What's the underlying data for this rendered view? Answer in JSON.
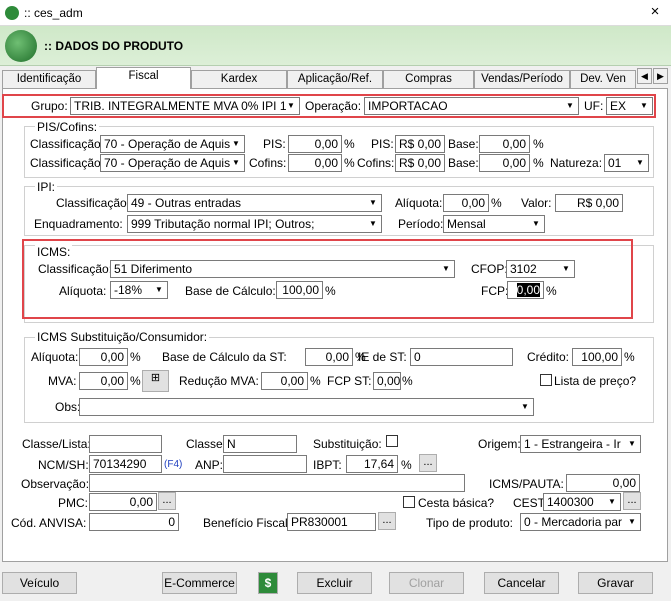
{
  "window": {
    "title": ":: ces_adm",
    "header": ":: DADOS DO PRODUTO"
  },
  "tabs": [
    "Identificação",
    "Fiscal",
    "Kardex",
    "Aplicação/Ref.",
    "Compras",
    "Vendas/Período",
    "Dev. Ven"
  ],
  "top": {
    "grupo_label": "Grupo:",
    "grupo_value": "TRIB. INTEGRALMENTE MVA 0% IPI 1",
    "operacao_label": "Operação:",
    "operacao_value": "IMPORTACAO",
    "uf_label": "UF:",
    "uf_value": "EX"
  },
  "piscofins": {
    "title": "PIS/Cofins:",
    "class_label": "Classificação:",
    "class1": "70 - Operação de Aquis",
    "class2": "70 - Operação de Aquis",
    "pis_label": "PIS:",
    "pis_pct": "0,00",
    "pct": "%",
    "pis2_label": "PIS:",
    "pis_val": "R$ 0,00",
    "base_label": "Base:",
    "base1": "0,00",
    "cofins_label": "Cofins:",
    "cofins_pct": "0,00",
    "cofins2_label": "Cofins:",
    "cofins_val": "R$ 0,00",
    "base2": "0,00",
    "natureza_label": "Natureza:",
    "natureza": "01"
  },
  "ipi": {
    "title": "IPI:",
    "class_label": "Classificação:",
    "class": "49 - Outras entradas",
    "aliq_label": "Alíquota:",
    "aliq": "0,00",
    "valor_label": "Valor:",
    "valor": "R$ 0,00",
    "enq_label": "Enquadramento:",
    "enq": "999 Tributação normal IPI; Outros;",
    "periodo_label": "Período:",
    "periodo": "Mensal"
  },
  "icms": {
    "title": "ICMS:",
    "class_label": "Classificação:",
    "class": "51 Diferimento",
    "cfop_label": "CFOP:",
    "cfop": "3102",
    "aliq_label": "Alíquota:",
    "aliq": "-18%",
    "base_label": "Base de Cálculo:",
    "base": "100,00",
    "fcp_label": "FCP:",
    "fcp": "0,00"
  },
  "icmsst": {
    "title": "ICMS Substituição/Consumidor:",
    "aliq_label": "Alíquota:",
    "aliq": "0,00",
    "base_label": "Base de Cálculo da ST:",
    "base": "0,00",
    "ie_label": "IE de ST:",
    "ie": "0",
    "credito_label": "Crédito:",
    "credito": "100,00",
    "mva_label": "MVA:",
    "mva": "0,00",
    "red_label": "Redução MVA:",
    "red": "0,00",
    "fcpst_label": "FCP ST:",
    "fcpst": "0,00",
    "lista_label": "Lista de preço?",
    "obs_label": "Obs:"
  },
  "lower": {
    "classe_lista_label": "Classe/Lista:",
    "classe_label": "Classe:",
    "classe": "N",
    "subst_label": "Substituição:",
    "origem_label": "Origem:",
    "origem": "1 - Estrangeira - Ir",
    "ncm_label": "NCM/SH:",
    "ncm": "70134290",
    "f4": "(F4)",
    "anp_label": "ANP:",
    "ibpt_label": "IBPT:",
    "ibpt": "17,64",
    "obs_label": "Observação:",
    "icmspauta_label": "ICMS/PAUTA:",
    "icmspauta": "0,00",
    "pmc_label": "PMC:",
    "pmc": "0,00",
    "cesta_label": "Cesta básica?",
    "cest_label": "CEST:",
    "cest": "1400300",
    "anvisa_label": "Cód. ANVISA:",
    "anvisa": "0",
    "benef_label": "Benefício Fiscal:",
    "benef": "PR830001",
    "tipo_label": "Tipo de produto:",
    "tipo": "0 - Mercadoria par"
  },
  "buttons": {
    "veiculo": "Veículo",
    "ecommerce": "E-Commerce",
    "dollar": "$",
    "excluir": "Excluir",
    "clonar": "Clonar",
    "cancelar": "Cancelar",
    "gravar": "Gravar"
  },
  "dots": "...",
  "close": "×"
}
